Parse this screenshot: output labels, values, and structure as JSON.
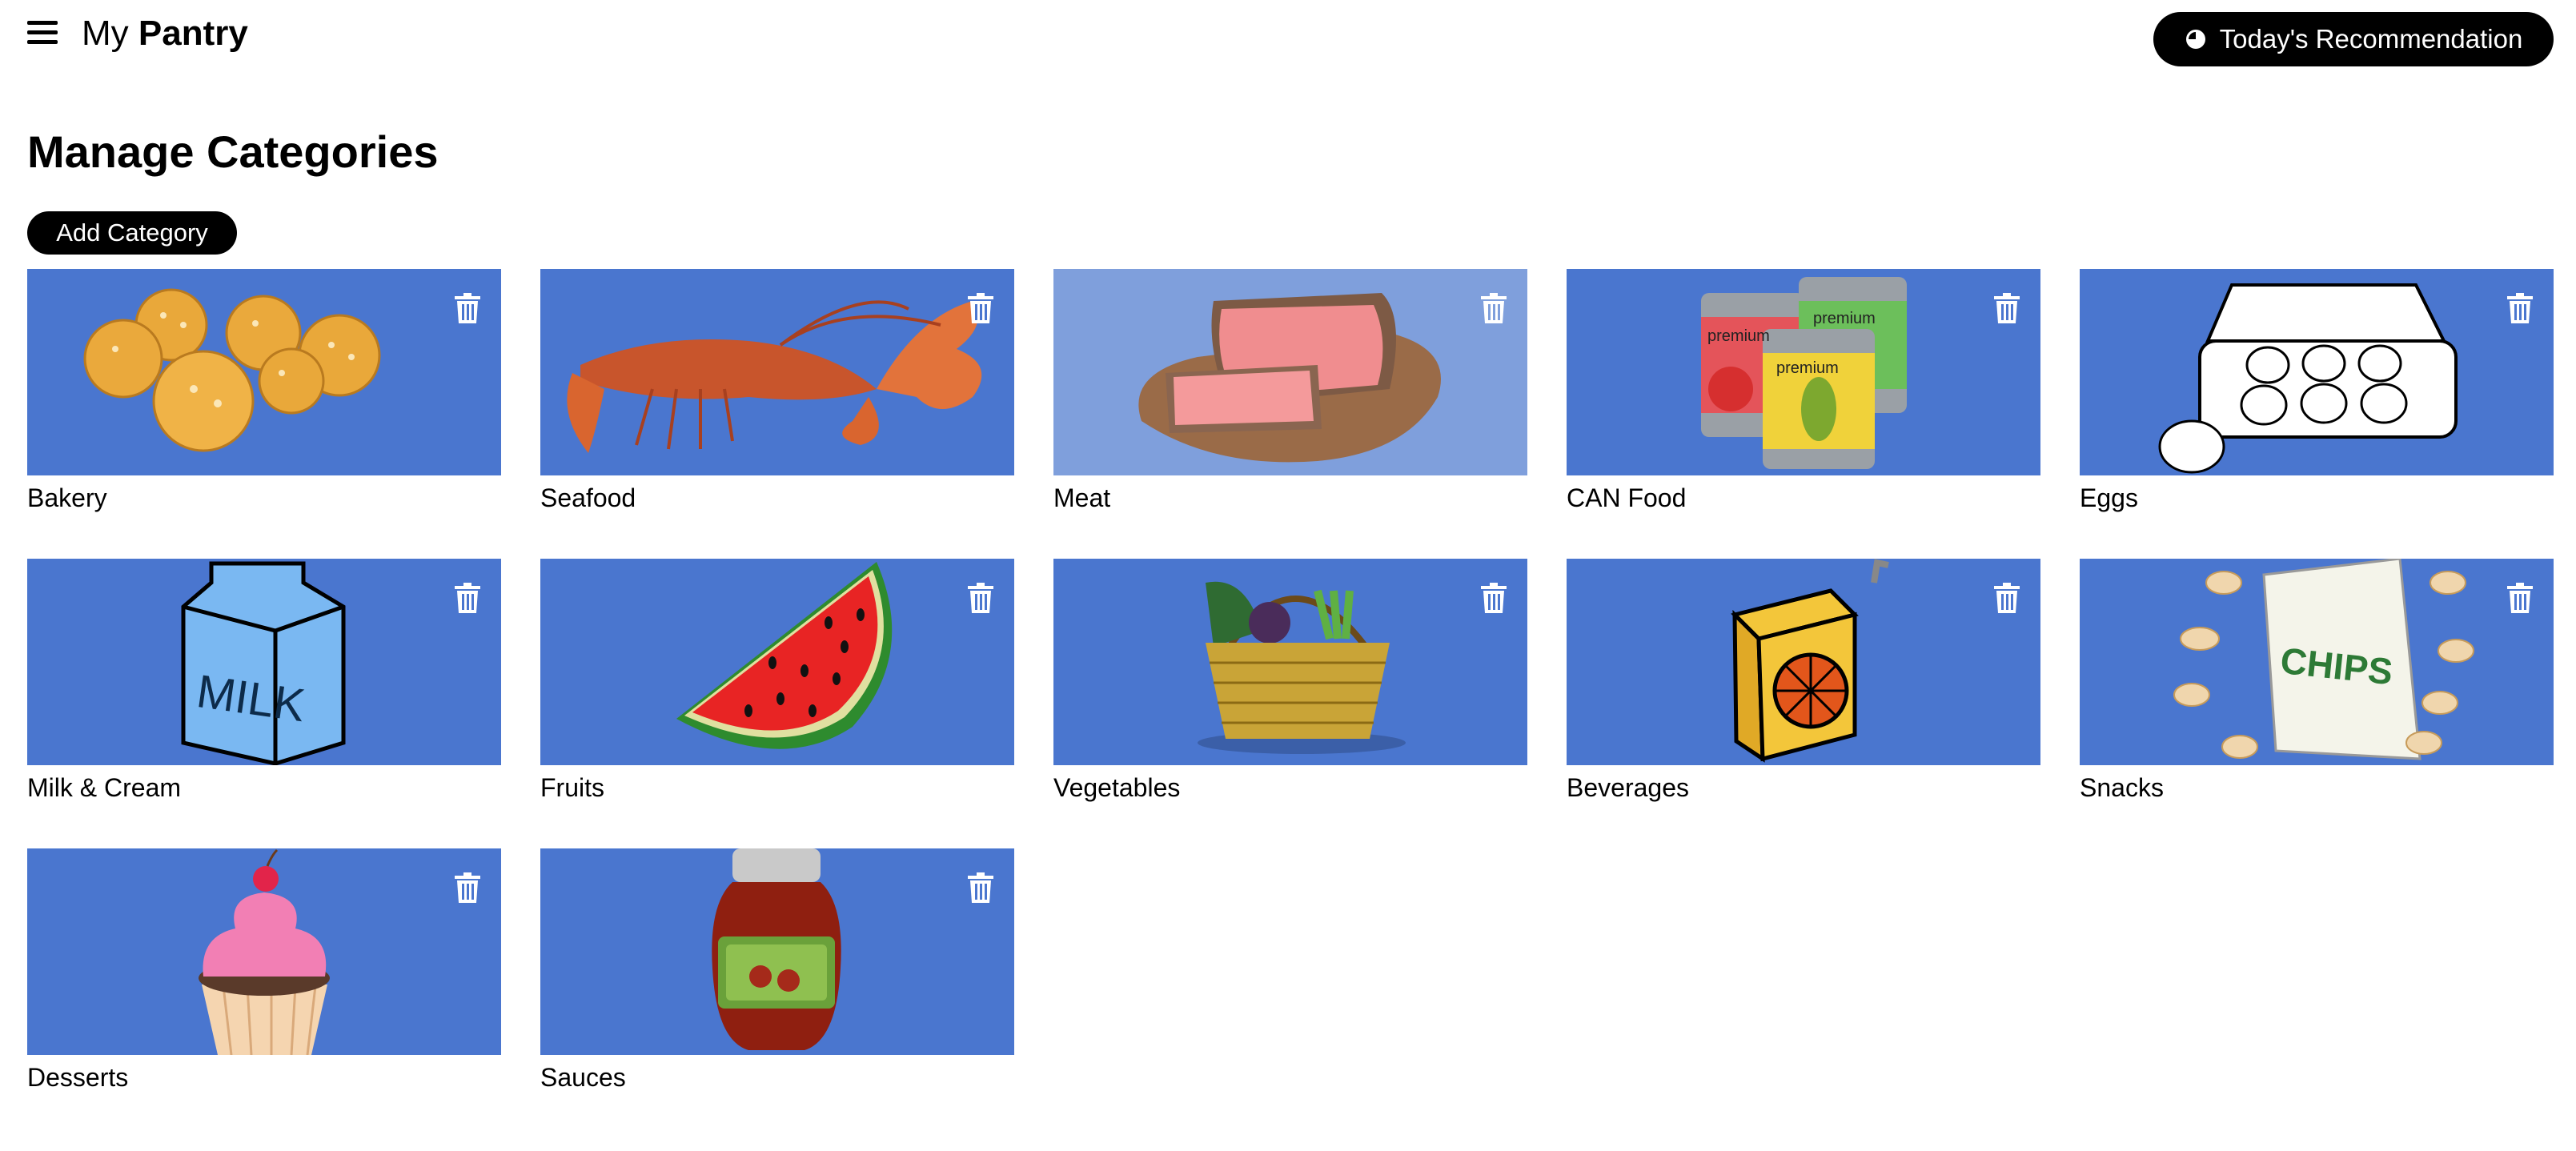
{
  "header": {
    "brand_prefix": "My",
    "brand_strong": "Pantry",
    "recommendation_label": "Today's Recommendation",
    "menu_icon": "hamburger-menu-icon",
    "recommendation_icon": "spinner-icon"
  },
  "page": {
    "title": "Manage Categories",
    "add_button_label": "Add Category"
  },
  "theme": {
    "card_background": "#4a76cf",
    "card_background_selected": "#7f9fdc",
    "button_background": "#000000",
    "button_text": "#ffffff"
  },
  "categories": [
    {
      "label": "Bakery",
      "icon": "bread-rolls-icon"
    },
    {
      "label": "Seafood",
      "icon": "lobster-icon"
    },
    {
      "label": "Meat",
      "icon": "sliced-meat-icon",
      "selected": true
    },
    {
      "label": "CAN Food",
      "icon": "canned-food-icon",
      "can_label": "premium"
    },
    {
      "label": "Eggs",
      "icon": "egg-carton-icon"
    },
    {
      "label": "Milk & Cream",
      "icon": "milk-carton-icon",
      "carton_text": "MILK"
    },
    {
      "label": "Fruits",
      "icon": "watermelon-slice-icon"
    },
    {
      "label": "Vegetables",
      "icon": "vegetable-basket-icon"
    },
    {
      "label": "Beverages",
      "icon": "juice-box-icon"
    },
    {
      "label": "Snacks",
      "icon": "chips-bag-icon",
      "bag_text": "CHIPS"
    },
    {
      "label": "Desserts",
      "icon": "cupcake-icon"
    },
    {
      "label": "Sauces",
      "icon": "sauce-jar-icon"
    }
  ],
  "delete_icon": "trash-icon"
}
